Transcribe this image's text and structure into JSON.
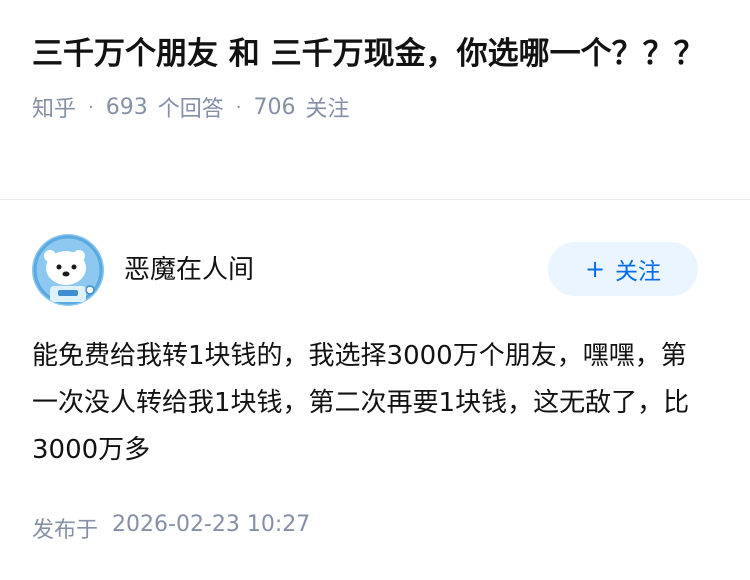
{
  "question": {
    "title": "三千万个朋友 和 三千万现金，你选哪一个？？？",
    "source": "知乎",
    "separator": "·",
    "answer_count": "693",
    "answer_label": "个回答",
    "follow_count": "706",
    "follow_label": "关注"
  },
  "answer": {
    "author_name": "恶魔在人间",
    "follow_button": {
      "plus": "+",
      "label": "关注"
    },
    "content": "能免费给我转1块钱的，我选择3000万个朋友，嘿嘿，第一次没人转给我1块钱，第二次再要1块钱，这无敌了，比3000万多",
    "publish_label": "发布于",
    "publish_time": "2026-02-23 10:27"
  },
  "colors": {
    "accent": "#056de8",
    "accent_bg": "#ebf5ff",
    "meta_text": "#8590a6",
    "avatar_bg": "#8cc8ef"
  },
  "icons": {
    "avatar": "polar-bear-astronaut-avatar"
  }
}
